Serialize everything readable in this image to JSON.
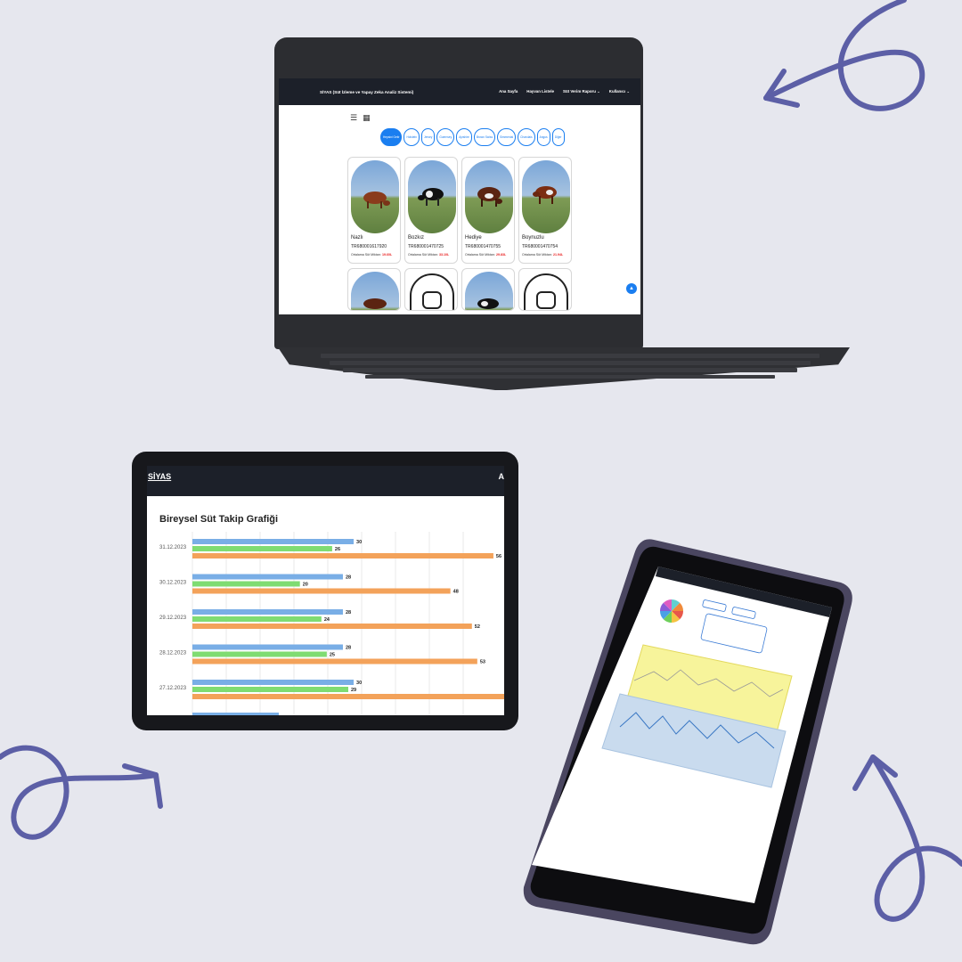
{
  "laptop": {
    "brand": "SİYAS (Süt İzleme ve Yapay Zeka Analiz Sistemi)",
    "menu": [
      "Ana Sayfa",
      "Hayvan Listele",
      "Süt Verim Raporu ⌄",
      "Kullanıcı ⌄"
    ],
    "filters": [
      "Hepsini Getir",
      "Holstein",
      "Jersey",
      "Guernsey",
      "Ayrshire",
      "Brown Swiss",
      "Simmental",
      "Charolais",
      "Angus",
      "Diğer"
    ],
    "active_filter": "Hepsini Getir",
    "avg_label": "Ortalama Süt Miktarı:",
    "cards": [
      {
        "name": "Nazlı",
        "tag": "TR680001617920",
        "avg": "19.60L"
      },
      {
        "name": "Bozkız",
        "tag": "TR680001470725",
        "avg": "33.10L"
      },
      {
        "name": "Hediye",
        "tag": "TR680001470755",
        "avg": "29.83L"
      },
      {
        "name": "Boynuzlu",
        "tag": "TR680001470754",
        "avg": "21.94L"
      }
    ]
  },
  "tablet": {
    "brand": "SİYAS",
    "edge_letter": "A",
    "chart_title": "Bireysel Süt Takip Grafiği"
  },
  "chart_data": {
    "type": "bar",
    "orientation": "horizontal",
    "title": "Bireysel Süt Takip Grafiği",
    "categories": [
      "31.12.2023",
      "30.12.2023",
      "29.12.2023",
      "28.12.2023",
      "27.12.2023"
    ],
    "series": [
      {
        "values": [
          30,
          28,
          28,
          28,
          30
        ],
        "color": "#79aee6"
      },
      {
        "values": [
          26,
          20,
          24,
          25,
          29
        ],
        "color": "#7fdc72"
      },
      {
        "values": [
          56,
          48,
          52,
          53,
          58
        ],
        "color": "#f3a25a"
      }
    ],
    "value_labels": [
      [
        "30",
        "26",
        "56"
      ],
      [
        "28",
        "20",
        "48"
      ],
      [
        "28",
        "24",
        "52"
      ],
      [
        "28",
        "25",
        "53"
      ],
      [
        "30",
        "29",
        ""
      ]
    ],
    "xlim": [
      0,
      58
    ],
    "grid": true
  },
  "phone": {
    "pie_colors": [
      "#e8574a",
      "#f5c342",
      "#6ecf5b",
      "#4aa0e6",
      "#8a5cd6",
      "#e05cc2",
      "#5fd0d0",
      "#f08a3a"
    ]
  },
  "colors": {
    "background": "#e6e7ee",
    "arrow": "#5c5fa6",
    "nav": "#1c2029",
    "accent": "#1a7ef0",
    "avg_value": "#e81c1c"
  },
  "icons": {
    "list_view": "list-view-icon",
    "grid_view": "grid-view-icon",
    "camera_placeholder": "camera-placeholder-icon",
    "scroll_top": "arrow-up-icon"
  }
}
